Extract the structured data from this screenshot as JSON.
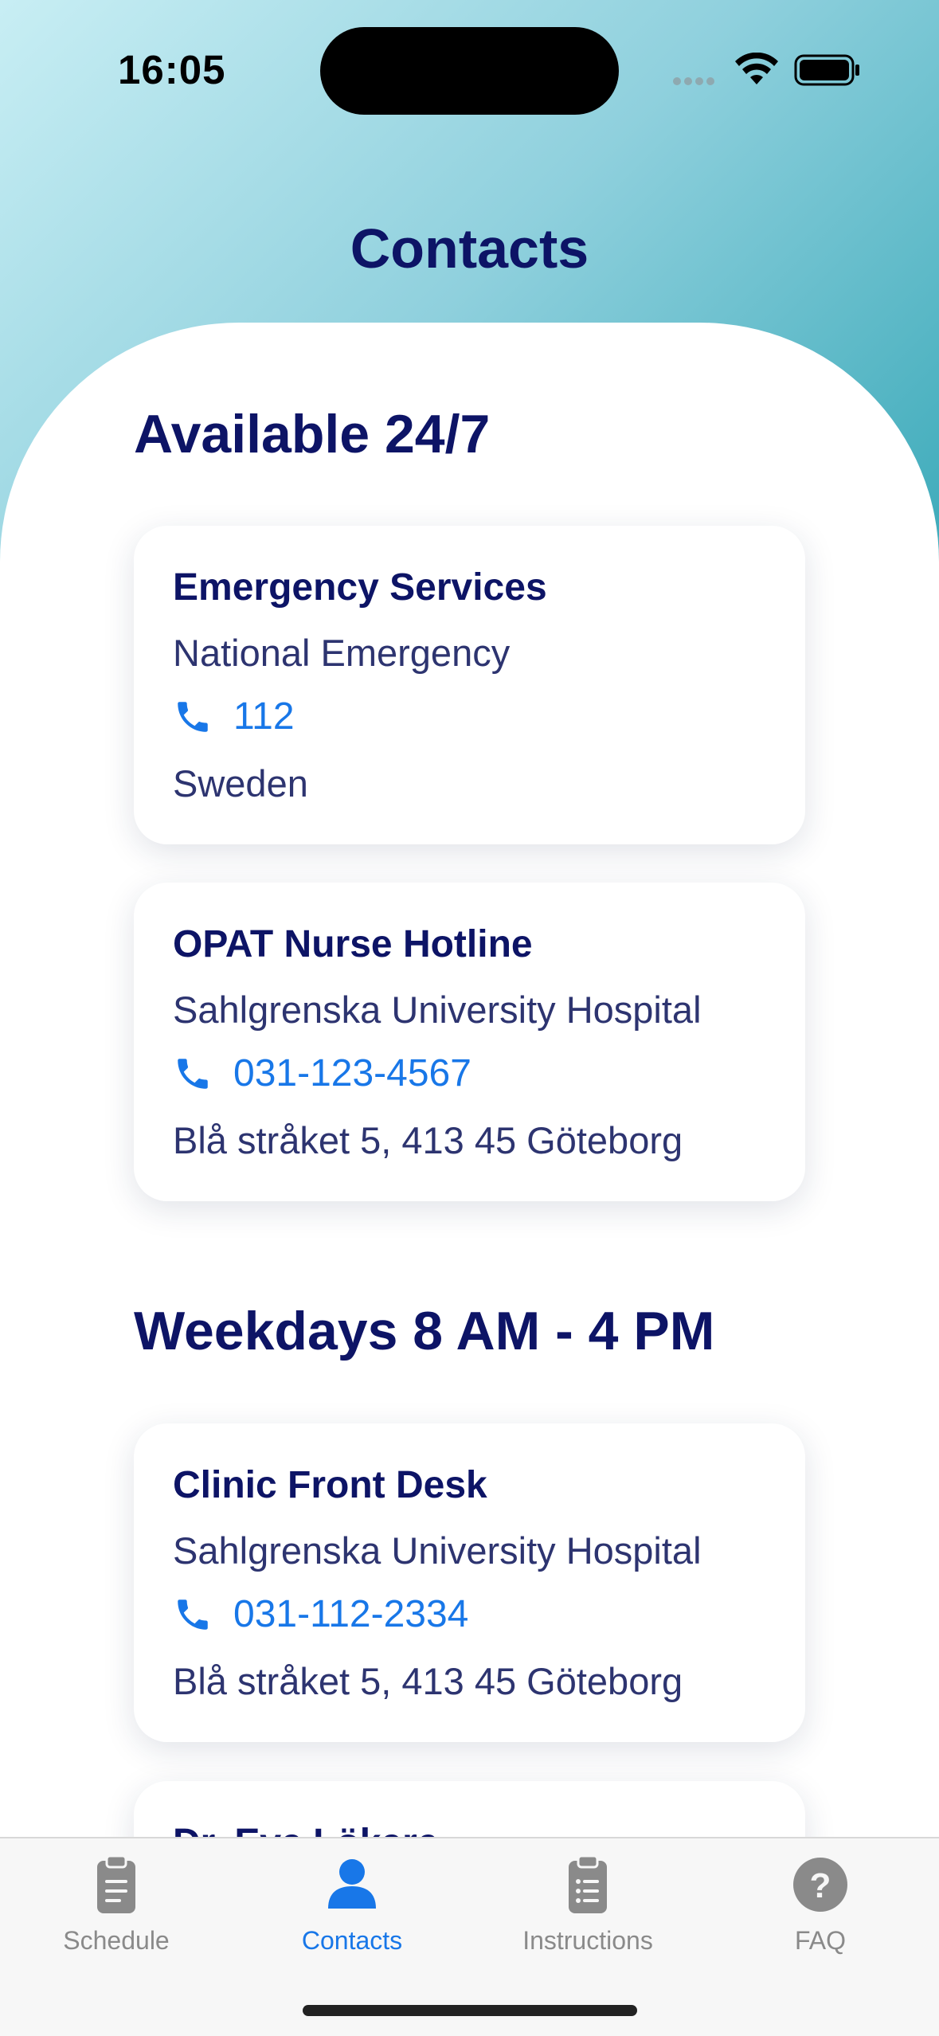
{
  "status_bar": {
    "time": "16:05"
  },
  "header": {
    "title": "Contacts"
  },
  "sections": [
    {
      "title": "Available 24/7",
      "contacts": [
        {
          "name": "Emergency Services",
          "organization": "National Emergency",
          "phone": "112",
          "location": "Sweden"
        },
        {
          "name": "OPAT Nurse Hotline",
          "organization": "Sahlgrenska University Hospital",
          "phone": "031-123-4567",
          "location": "Blå stråket 5, 413 45 Göteborg"
        }
      ]
    },
    {
      "title": "Weekdays 8 AM - 4 PM",
      "contacts": [
        {
          "name": "Clinic Front Desk",
          "organization": "Sahlgrenska University Hospital",
          "phone": "031-112-2334",
          "location": "Blå stråket 5, 413 45 Göteborg"
        },
        {
          "name": "Dr. Eva Lökare"
        }
      ]
    }
  ],
  "tab_bar": {
    "tabs": [
      {
        "label": "Schedule",
        "icon": "clipboard-icon"
      },
      {
        "label": "Contacts",
        "icon": "person-icon"
      },
      {
        "label": "Instructions",
        "icon": "list-clipboard-icon"
      },
      {
        "label": "FAQ",
        "icon": "question-circle-icon"
      }
    ],
    "active_tab": "Contacts"
  },
  "colors": {
    "title": "#0d1466",
    "link": "#1877e8",
    "gradient_start": "#c8eef4",
    "gradient_end": "#2aa2b2"
  }
}
